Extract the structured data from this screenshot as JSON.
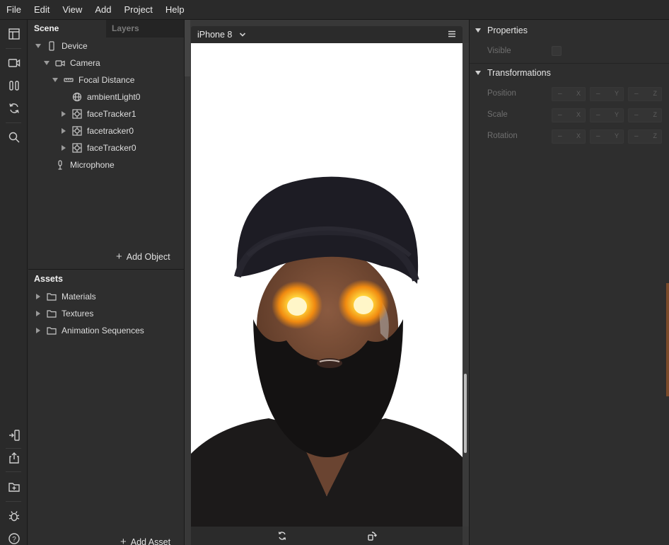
{
  "menubar": {
    "items": [
      "File",
      "Edit",
      "View",
      "Add",
      "Project",
      "Help"
    ]
  },
  "toolbar": {
    "tools": [
      "layout-icon",
      "video-camera-icon",
      "columns-icon",
      "refresh-icon",
      "search-icon",
      "device-connect-icon",
      "share-icon",
      "add-folder-icon",
      "bug-icon",
      "help-icon"
    ],
    "help_glyph": "?"
  },
  "scene": {
    "tab_active": "Scene",
    "tab_inactive": "Layers",
    "tree": [
      {
        "label": "Device",
        "icon": "phone-icon",
        "expanded": true
      },
      {
        "label": "Camera",
        "icon": "camera-icon",
        "expanded": true
      },
      {
        "label": "Focal Distance",
        "icon": "ruler-icon",
        "expanded": true
      },
      {
        "label": "ambientLight0",
        "icon": "globe-icon",
        "expanded": false
      },
      {
        "label": "faceTracker1",
        "icon": "face-tracker-icon",
        "expanded": false
      },
      {
        "label": "facetracker0",
        "icon": "face-tracker-icon",
        "expanded": false
      },
      {
        "label": "faceTracker0",
        "icon": "face-tracker-icon",
        "expanded": false
      },
      {
        "label": "Microphone",
        "icon": "microphone-icon",
        "expanded": false
      }
    ],
    "add_object": "Add Object"
  },
  "assets": {
    "title": "Assets",
    "items": [
      "Materials",
      "Textures",
      "Animation Sequences"
    ],
    "add_asset": "Add Asset"
  },
  "viewport": {
    "device": "iPhone 8",
    "footer_icons": [
      "rotate-camera-icon",
      "rotate-device-icon"
    ]
  },
  "properties": {
    "section_properties": "Properties",
    "visible_label": "Visible",
    "section_transformations": "Transformations",
    "rows": [
      {
        "label": "Position",
        "values": [
          "–",
          "–",
          "–"
        ]
      },
      {
        "label": "Scale",
        "values": [
          "–",
          "–",
          "–"
        ]
      },
      {
        "label": "Rotation",
        "values": [
          "–",
          "–",
          "–"
        ]
      }
    ],
    "axes": [
      "X",
      "Y",
      "Z"
    ]
  }
}
